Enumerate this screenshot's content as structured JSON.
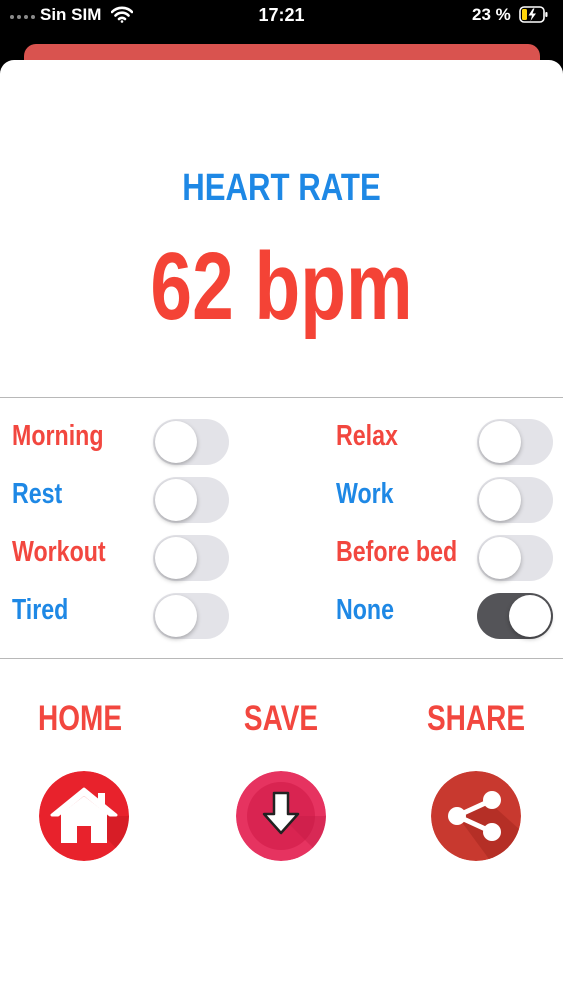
{
  "status_bar": {
    "carrier": "Sin SIM",
    "time": "17:21",
    "battery": "23 %"
  },
  "heart_rate": {
    "title": "HEART RATE",
    "value": "62 bpm"
  },
  "tags": [
    {
      "label": "Morning",
      "color": "#f2473f",
      "on": false
    },
    {
      "label": "Relax",
      "color": "#f2473f",
      "on": false
    },
    {
      "label": "Rest",
      "color": "#1e88e5",
      "on": false
    },
    {
      "label": "Work",
      "color": "#1e88e5",
      "on": false
    },
    {
      "label": "Workout",
      "color": "#f2473f",
      "on": false
    },
    {
      "label": "Before bed",
      "color": "#f2473f",
      "on": false
    },
    {
      "label": "Tired",
      "color": "#1e88e5",
      "on": false
    },
    {
      "label": "None",
      "color": "#1e88e5",
      "on": true
    }
  ],
  "actions": {
    "home": {
      "label": "HOME",
      "icon": "house-icon"
    },
    "save": {
      "label": "SAVE",
      "icon": "download-arrow-icon"
    },
    "share": {
      "label": "SHARE",
      "icon": "share-icon"
    }
  },
  "colors": {
    "accent_red": "#f2473f",
    "accent_blue": "#1e88e5",
    "home_button": "#e8222c",
    "save_button": "#e63360",
    "share_button": "#c8392f"
  }
}
